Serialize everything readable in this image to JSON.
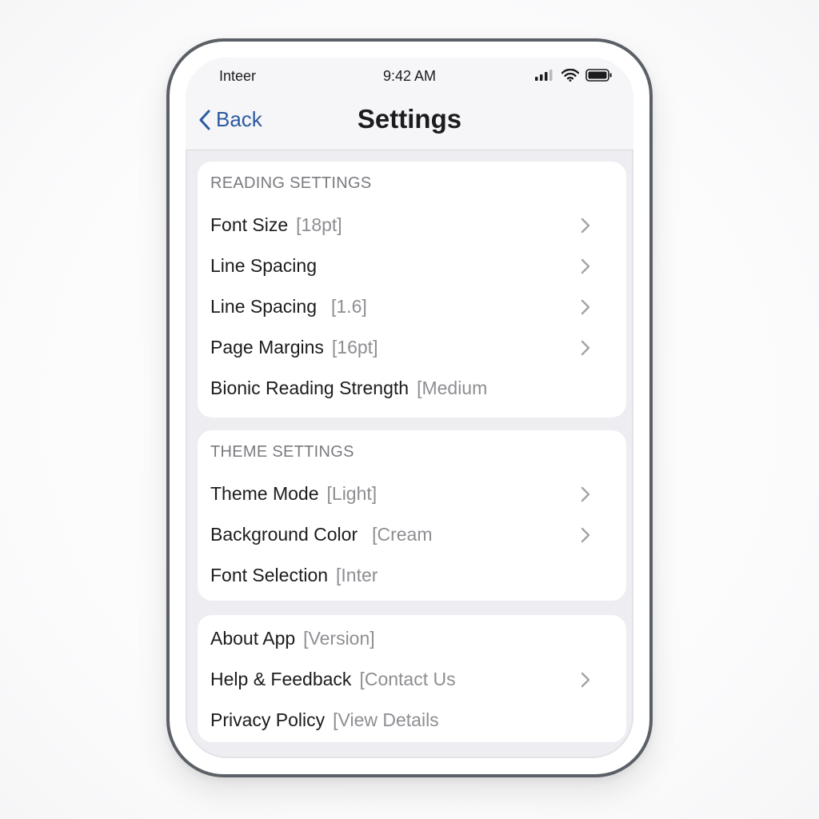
{
  "status_bar": {
    "carrier": "Inteer",
    "time": "9:42 AM",
    "icons": [
      "signal-icon",
      "wifi-icon",
      "battery-icon"
    ]
  },
  "nav": {
    "back_label": "Back",
    "title": "Settings"
  },
  "sections": [
    {
      "header": "READING SETTINGS",
      "rows": [
        {
          "label": "Font Size",
          "value": "[18pt]",
          "chevron": true
        },
        {
          "label": "Line Spacing",
          "value": "",
          "chevron": true
        },
        {
          "label": "Line Spacing",
          "value": "[1.6]",
          "chevron": true
        },
        {
          "label": "Page Margins",
          "value": "[16pt]",
          "chevron": true
        },
        {
          "label": "Bionic Reading Strength",
          "value": "[Medium",
          "chevron": false
        }
      ]
    },
    {
      "header": "THEME SETTINGS",
      "rows": [
        {
          "label": "Theme Mode",
          "value": "[Light]",
          "chevron": true
        },
        {
          "label": "Background Color",
          "value": "[Cream",
          "chevron": true
        },
        {
          "label": "Font Selection",
          "value": "[Inter",
          "chevron": false
        }
      ]
    },
    {
      "header": "",
      "rows": [
        {
          "label": "About App",
          "value": "[Version]",
          "chevron": false
        },
        {
          "label": "Help & Feedback",
          "value": "[Contact Us",
          "chevron": true
        },
        {
          "label": "Privacy Policy",
          "value": "[View Details",
          "chevron": false
        }
      ]
    }
  ],
  "colors": {
    "accent": "#2c5aa0",
    "background": "#ededf2",
    "label": "#1c1c1e",
    "secondary": "#8e8e93"
  }
}
